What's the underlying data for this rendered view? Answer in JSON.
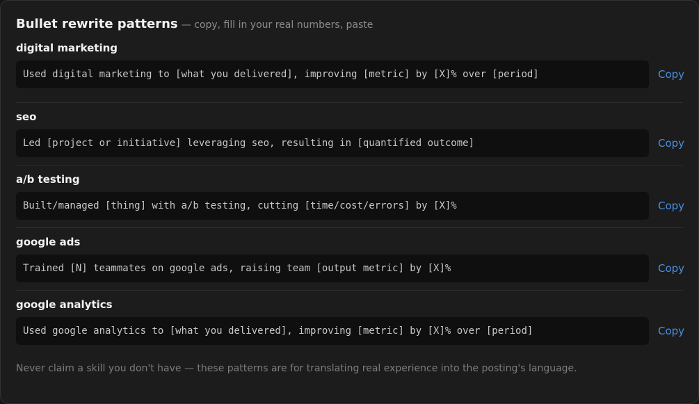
{
  "header": {
    "title": "Bullet rewrite patterns",
    "subtitle": "— copy, fill in your real numbers, paste"
  },
  "rows": [
    {
      "skill": "digital marketing",
      "pattern": "Used digital marketing to [what you delivered], improving [metric] by [X]% over [period]",
      "copy_label": "Copy"
    },
    {
      "skill": "seo",
      "pattern": "Led [project or initiative] leveraging seo, resulting in [quantified outcome]",
      "copy_label": "Copy"
    },
    {
      "skill": "a/b testing",
      "pattern": "Built/managed [thing] with a/b testing, cutting [time/cost/errors] by [X]%",
      "copy_label": "Copy"
    },
    {
      "skill": "google ads",
      "pattern": "Trained [N] teammates on google ads, raising team [output metric] by [X]%",
      "copy_label": "Copy"
    },
    {
      "skill": "google analytics",
      "pattern": "Used google analytics to [what you delivered], improving [metric] by [X]% over [period]",
      "copy_label": "Copy"
    }
  ],
  "footer": {
    "note": "Never claim a skill you don't have — these patterns are for translating real experience into the posting's language."
  },
  "colors": {
    "accent": "#4a90e2",
    "background": "#1c1c1c",
    "code_background": "#0f0f0f"
  }
}
